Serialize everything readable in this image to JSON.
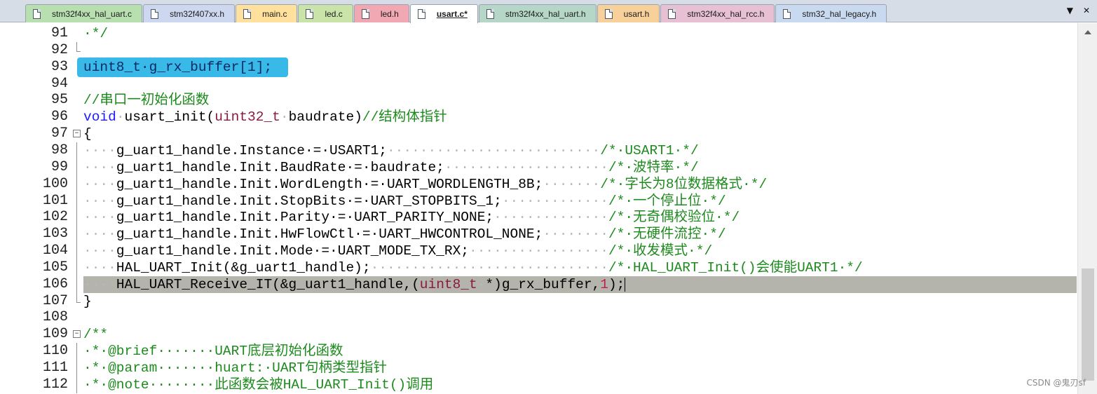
{
  "tabs": [
    {
      "label": "stm32f4xx_hal_uart.c",
      "color": "#b7dfb0",
      "active": false
    },
    {
      "label": "stm32f407xx.h",
      "color": "#cdd8f0",
      "active": false
    },
    {
      "label": "main.c",
      "color": "#ffe09c",
      "active": false
    },
    {
      "label": "led.c",
      "color": "#c9e3a9",
      "active": false
    },
    {
      "label": "led.h",
      "color": "#f2a8b3",
      "active": false
    },
    {
      "label": "usart.c*",
      "color": "#ffffff",
      "active": true
    },
    {
      "label": "stm32f4xx_hal_uart.h",
      "color": "#b6d7c7",
      "active": false
    },
    {
      "label": "usart.h",
      "color": "#f8d09a",
      "active": false
    },
    {
      "label": "stm32f4xx_hal_rcc.h",
      "color": "#e8c0d4",
      "active": false
    },
    {
      "label": "stm32_hal_legacy.h",
      "color": "#c9daf0",
      "active": false
    }
  ],
  "tab_controls": {
    "dropdown_icon": "▼",
    "close_icon": "✕"
  },
  "lines": [
    {
      "num": "91",
      "fold": "",
      "segments": [
        {
          "t": "·*/",
          "c": "cm"
        }
      ]
    },
    {
      "num": "92",
      "fold": "end",
      "segments": []
    },
    {
      "num": "93",
      "fold": "",
      "selected": true,
      "segments": [
        {
          "t": "uint8_t·g_rx_buffer[1];",
          "c": "sel"
        }
      ]
    },
    {
      "num": "94",
      "fold": "",
      "segments": []
    },
    {
      "num": "95",
      "fold": "",
      "segments": [
        {
          "t": "//串口一初始化函数",
          "c": "cm"
        }
      ]
    },
    {
      "num": "96",
      "fold": "",
      "segments": [
        {
          "t": "void",
          "c": "kw"
        },
        {
          "t": "·",
          "c": "ws"
        },
        {
          "t": "usart_init(",
          "c": ""
        },
        {
          "t": "uint32_t",
          "c": "ty"
        },
        {
          "t": "·",
          "c": "ws"
        },
        {
          "t": "baudrate)",
          "c": ""
        },
        {
          "t": "//结构体指针",
          "c": "cm"
        }
      ]
    },
    {
      "num": "97",
      "fold": "open",
      "segments": [
        {
          "t": "{",
          "c": ""
        }
      ]
    },
    {
      "num": "98",
      "fold": "",
      "segments": [
        {
          "t": "····",
          "c": "ws"
        },
        {
          "t": "g_uart1_handle.Instance·=·USART1;",
          "c": ""
        },
        {
          "t": "··························",
          "c": "ws"
        },
        {
          "t": "/*·USART1·*/",
          "c": "cm"
        }
      ]
    },
    {
      "num": "99",
      "fold": "",
      "segments": [
        {
          "t": "····",
          "c": "ws"
        },
        {
          "t": "g_uart1_handle.Init.BaudRate·=·baudrate;",
          "c": ""
        },
        {
          "t": "····················",
          "c": "ws"
        },
        {
          "t": "/*·波特率·*/",
          "c": "cm"
        }
      ]
    },
    {
      "num": "100",
      "fold": "",
      "segments": [
        {
          "t": "····",
          "c": "ws"
        },
        {
          "t": "g_uart1_handle.Init.WordLength·=·UART_WORDLENGTH_8B;",
          "c": ""
        },
        {
          "t": "·······",
          "c": "ws"
        },
        {
          "t": "/*·字长为8位数据格式·*/",
          "c": "cm"
        }
      ]
    },
    {
      "num": "101",
      "fold": "",
      "segments": [
        {
          "t": "····",
          "c": "ws"
        },
        {
          "t": "g_uart1_handle.Init.StopBits·=·UART_STOPBITS_1;",
          "c": ""
        },
        {
          "t": "·············",
          "c": "ws"
        },
        {
          "t": "/*·一个停止位·*/",
          "c": "cm"
        }
      ]
    },
    {
      "num": "102",
      "fold": "",
      "segments": [
        {
          "t": "····",
          "c": "ws"
        },
        {
          "t": "g_uart1_handle.Init.Parity·=·UART_PARITY_NONE;",
          "c": ""
        },
        {
          "t": "··············",
          "c": "ws"
        },
        {
          "t": "/*·无奇偶校验位·*/",
          "c": "cm"
        }
      ]
    },
    {
      "num": "103",
      "fold": "",
      "segments": [
        {
          "t": "····",
          "c": "ws"
        },
        {
          "t": "g_uart1_handle.Init.HwFlowCtl·=·UART_HWCONTROL_NONE;",
          "c": ""
        },
        {
          "t": "········",
          "c": "ws"
        },
        {
          "t": "/*·无硬件流控·*/",
          "c": "cm"
        }
      ]
    },
    {
      "num": "104",
      "fold": "",
      "segments": [
        {
          "t": "····",
          "c": "ws"
        },
        {
          "t": "g_uart1_handle.Init.Mode·=·UART_MODE_TX_RX;",
          "c": ""
        },
        {
          "t": "·················",
          "c": "ws"
        },
        {
          "t": "/*·收发模式·*/",
          "c": "cm"
        }
      ]
    },
    {
      "num": "105",
      "fold": "",
      "segments": [
        {
          "t": "····",
          "c": "ws"
        },
        {
          "t": "HAL_UART_Init(&g_uart1_handle);",
          "c": ""
        },
        {
          "t": "·····························",
          "c": "ws"
        },
        {
          "t": "/*·HAL_UART_Init()会使能UART1·*/",
          "c": "cm"
        }
      ]
    },
    {
      "num": "106",
      "fold": "",
      "current": true,
      "segments": [
        {
          "t": "····",
          "c": "ws"
        },
        {
          "t": "HAL_UART_Receive_IT(&g_uart1_handle,(",
          "c": ""
        },
        {
          "t": "uint8_t",
          "c": "ty"
        },
        {
          "t": "·",
          "c": "ws"
        },
        {
          "t": "*)g_rx_buffer,",
          "c": ""
        },
        {
          "t": "1",
          "c": "num"
        },
        {
          "t": ");",
          "c": ""
        }
      ]
    },
    {
      "num": "107",
      "fold": "end",
      "segments": [
        {
          "t": "}",
          "c": ""
        }
      ]
    },
    {
      "num": "108",
      "fold": "",
      "segments": []
    },
    {
      "num": "109",
      "fold": "open",
      "segments": [
        {
          "t": "/**",
          "c": "cm"
        }
      ]
    },
    {
      "num": "110",
      "fold": "",
      "segments": [
        {
          "t": "·*·@brief·······UART底层初始化函数",
          "c": "cm"
        }
      ]
    },
    {
      "num": "111",
      "fold": "",
      "segments": [
        {
          "t": "·*·@param·······huart:·UART句柄类型指针",
          "c": "cm"
        }
      ]
    },
    {
      "num": "112",
      "fold": "",
      "segments": [
        {
          "t": "·*·@note········此函数会被HAL_UART_Init()调用",
          "c": "cm"
        }
      ]
    }
  ],
  "watermark": "CSDN @鬼刃sf"
}
